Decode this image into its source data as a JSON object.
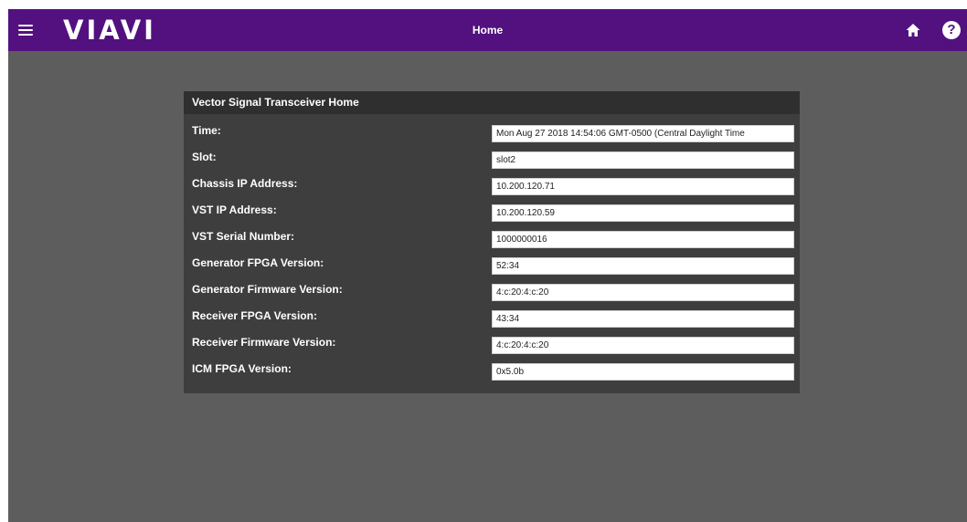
{
  "app": {
    "logo_text": "VIAVI",
    "page_title": "Home",
    "brand_color": "#52117f",
    "icons": [
      "menu-icon",
      "home-icon",
      "help-icon"
    ]
  },
  "panel": {
    "title": "Vector Signal Transceiver Home",
    "rows": [
      {
        "label": "Time:",
        "value": "Mon Aug 27 2018 14:54:06 GMT-0500 (Central Daylight Time"
      },
      {
        "label": "Slot:",
        "value": "slot2"
      },
      {
        "label": "Chassis IP Address:",
        "value": "10.200.120.71"
      },
      {
        "label": "VST IP Address:",
        "value": "10.200.120.59"
      },
      {
        "label": "VST Serial Number:",
        "value": "1000000016"
      },
      {
        "label": "Generator FPGA Version:",
        "value": "52:34"
      },
      {
        "label": "Generator Firmware Version:",
        "value": "4:c:20:4:c:20"
      },
      {
        "label": "Receiver FPGA Version:",
        "value": "43:34"
      },
      {
        "label": "Receiver Firmware Version:",
        "value": "4:c:20:4:c:20"
      },
      {
        "label": "ICM FPGA Version:",
        "value": "0x5.0b"
      }
    ]
  }
}
